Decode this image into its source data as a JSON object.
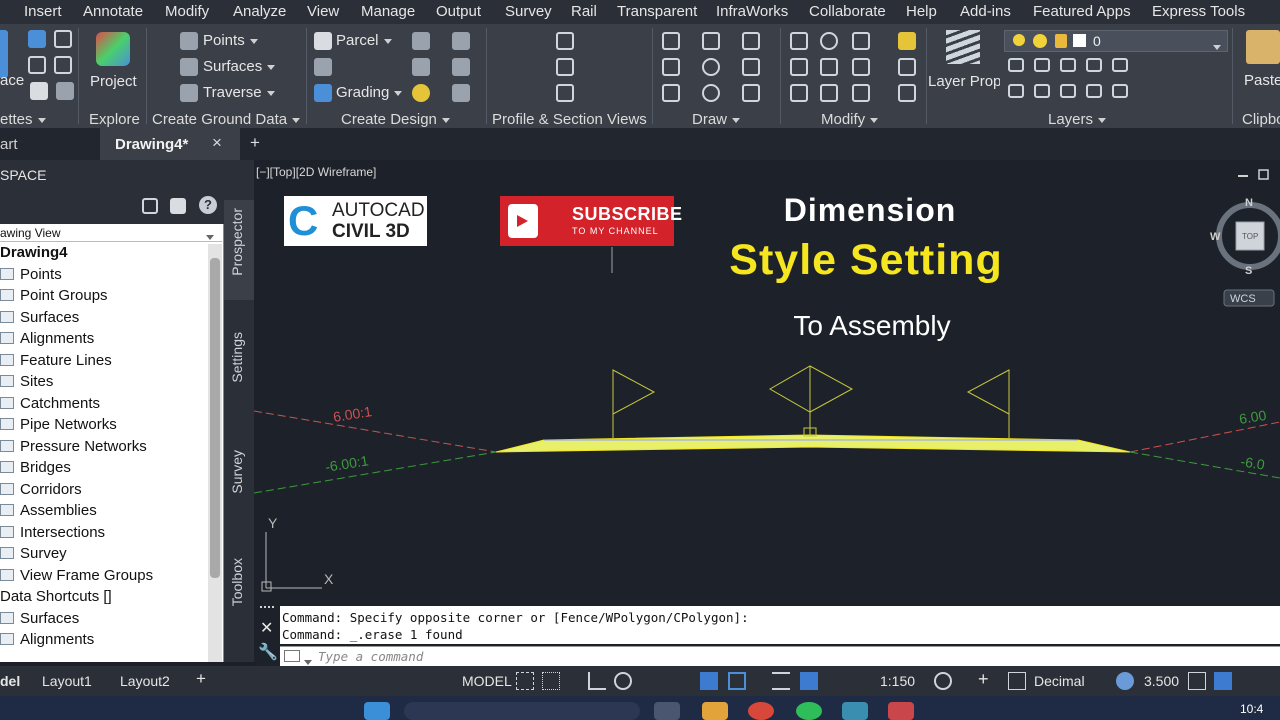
{
  "menubar": {
    "items": [
      "Insert",
      "Annotate",
      "Modify",
      "Analyze",
      "View",
      "Manage",
      "Output",
      "Survey",
      "Rail",
      "Transparent",
      "InfraWorks",
      "Collaborate",
      "Help",
      "Add-ins",
      "Featured Apps",
      "Express Tools"
    ]
  },
  "ribbon": {
    "panels": [
      "ettes",
      "Explore",
      "Create Ground Data",
      "Create Design",
      "Profile & Section Views",
      "Draw",
      "Modify",
      "Layers",
      "Clipbo"
    ],
    "buttons": {
      "space": "ace",
      "project_explorer": "Project Explorer",
      "points": "Points",
      "surfaces": "Surfaces",
      "traverse": "Traverse",
      "parcel": "Parcel",
      "grading": "Grading",
      "layer_properties": "Layer Properties",
      "layer_value": "0",
      "paste": "Paste"
    }
  },
  "tabs": {
    "start": "art",
    "drawing": "Drawing4*",
    "close": "×",
    "add": "+"
  },
  "palette": {
    "header": "SPACE",
    "view_select": "awing View",
    "tree": [
      {
        "label": "Drawing4",
        "bold": true
      },
      {
        "label": "Points"
      },
      {
        "label": "Point Groups"
      },
      {
        "label": "Surfaces"
      },
      {
        "label": "Alignments"
      },
      {
        "label": "Feature Lines"
      },
      {
        "label": "Sites"
      },
      {
        "label": "Catchments"
      },
      {
        "label": "Pipe Networks"
      },
      {
        "label": "Pressure Networks"
      },
      {
        "label": "Bridges"
      },
      {
        "label": "Corridors"
      },
      {
        "label": "Assemblies"
      },
      {
        "label": "Intersections"
      },
      {
        "label": "Survey"
      },
      {
        "label": "View Frame Groups"
      },
      {
        "label": "Data Shortcuts []"
      },
      {
        "label": "Surfaces"
      },
      {
        "label": "Alignments"
      }
    ]
  },
  "side_tabs": [
    "Prospector",
    "Settings",
    "Survey",
    "Toolbox"
  ],
  "viewport": {
    "label": "[−][Top][2D Wireframe]",
    "logo_line1": "AUTOCAD",
    "logo_line2": "CIVIL 3D",
    "subscribe_line1": "SUBSCRIBE",
    "subscribe_line2": "TO MY CHANNEL",
    "title1": "Dimension",
    "title2": "Style Setting",
    "title3": "To Assembly",
    "slope_labels": [
      "6.00:1",
      "-6.00:1",
      "6.00",
      "-6.0"
    ],
    "viewcube": {
      "n": "N",
      "s": "S",
      "w": "W",
      "top": "TOP",
      "wcs": "WCS"
    },
    "ucs": {
      "x": "X",
      "y": "Y"
    }
  },
  "command": {
    "history": [
      "Command: Specify opposite corner or [Fence/WPolygon/CPolygon]:",
      "Command: _.erase 1 found"
    ],
    "placeholder": "Type a command"
  },
  "statusbar": {
    "tabs": [
      "del",
      "Layout1",
      "Layout2"
    ],
    "model": "MODEL",
    "scale": "1:150",
    "units": "Decimal",
    "elevation": "3.500"
  },
  "taskbar": {
    "time": "10:4"
  },
  "colors": {
    "accent_yellow": "#f5e620",
    "road_fill": "#e8f06a",
    "slope_red": "#d05050",
    "slope_green": "#3f9a3f"
  }
}
